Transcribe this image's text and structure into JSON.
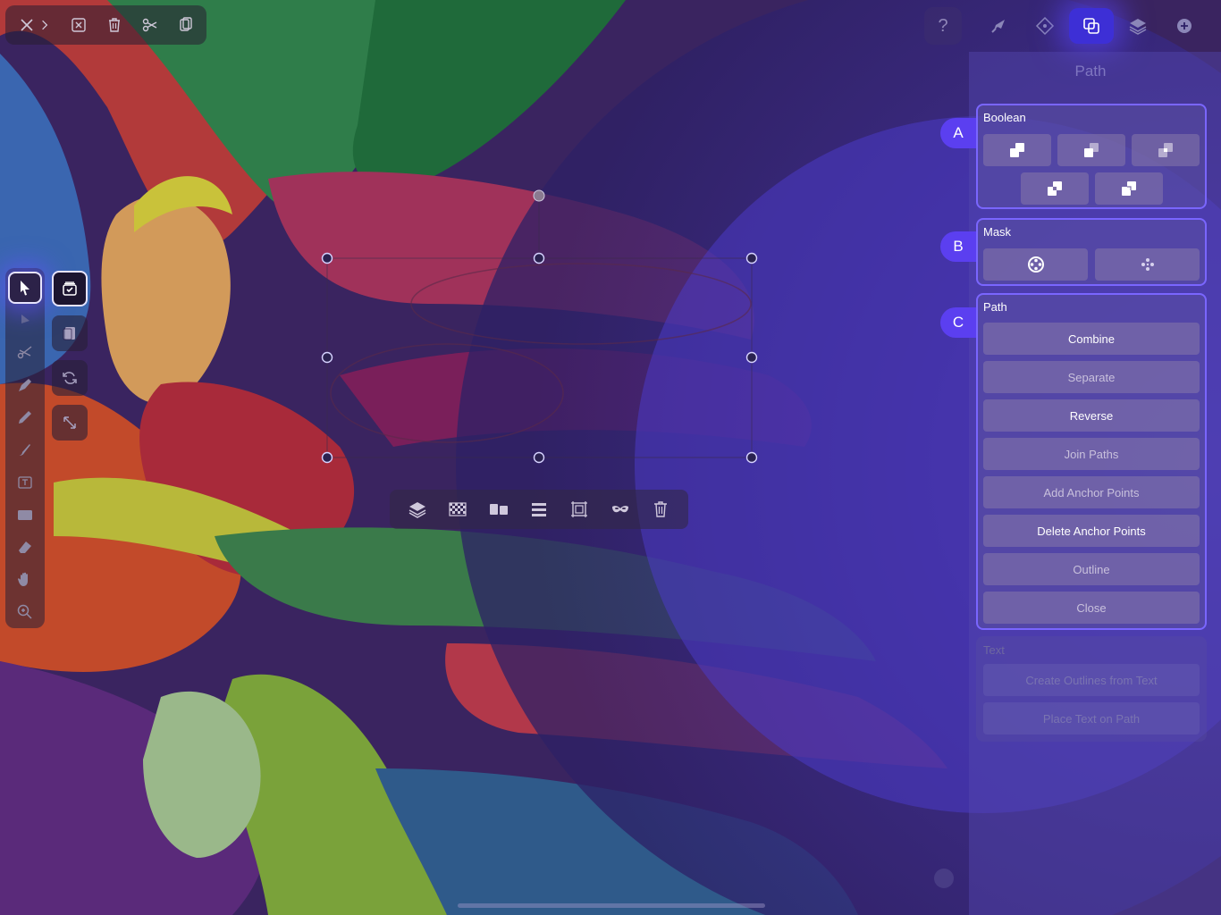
{
  "panel": {
    "title": "Path",
    "boolean": {
      "label": "Boolean",
      "badge": "A",
      "buttons": [
        "union-icon",
        "subtract-icon",
        "intersect-icon",
        "exclude-icon",
        "divide-icon"
      ]
    },
    "mask": {
      "label": "Mask",
      "badge": "B",
      "buttons": [
        "mask-icon",
        "unmask-icon"
      ]
    },
    "path": {
      "label": "Path",
      "badge": "C",
      "buttons": [
        "Combine",
        "Separate",
        "Reverse",
        "Join Paths",
        "Add Anchor Points",
        "Delete Anchor Points",
        "Outline",
        "Close"
      ]
    },
    "text": {
      "label": "Text",
      "buttons": [
        "Create Outlines from Text",
        "Place Text on Path"
      ]
    }
  },
  "help": {
    "label": "?"
  },
  "colors": {
    "accent": "#5b3ff0",
    "section_border": "#7a66ff",
    "active_tab": "#3d2fd6"
  }
}
